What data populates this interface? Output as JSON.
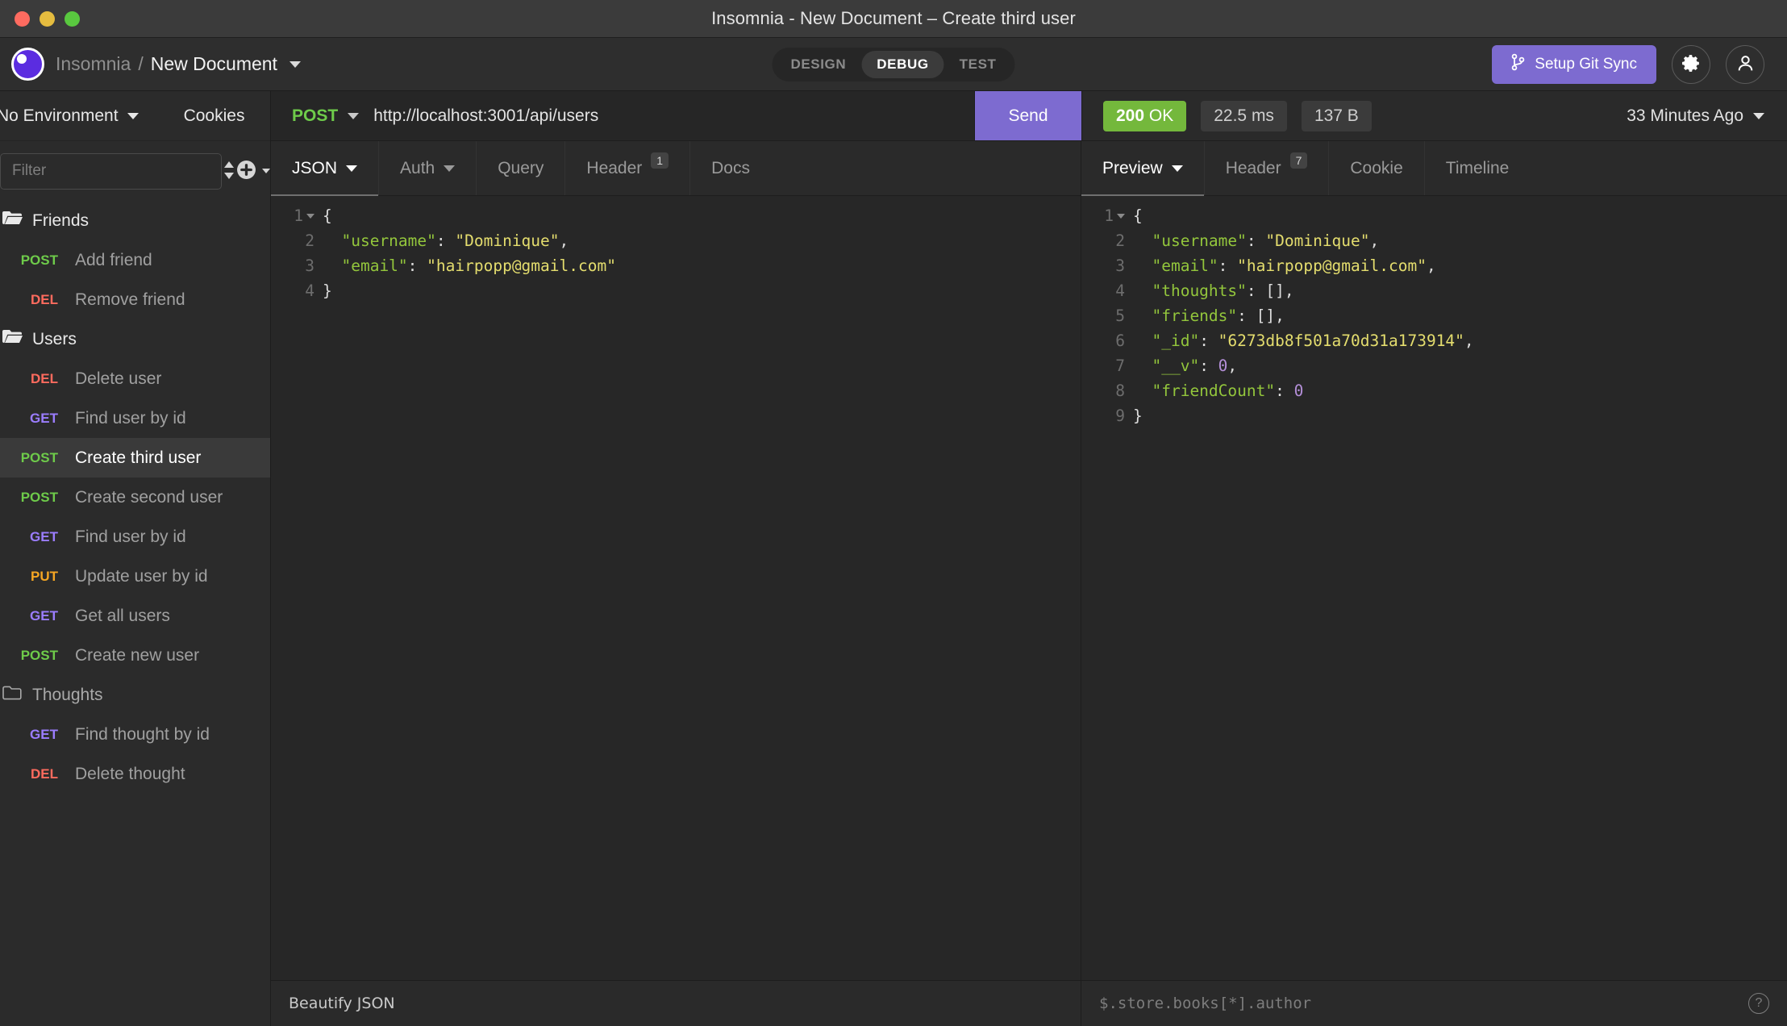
{
  "window": {
    "title": "Insomnia - New Document – Create third user"
  },
  "header": {
    "app_name": "Insomnia",
    "separator": "/",
    "document_name": "New Document",
    "modes": [
      {
        "label": "DESIGN",
        "active": false
      },
      {
        "label": "DEBUG",
        "active": true
      },
      {
        "label": "TEST",
        "active": false
      }
    ],
    "git_sync_label": "Setup Git Sync",
    "accent_color": "#7d6bd0"
  },
  "sidebar": {
    "environment_label": "No Environment",
    "cookies_label": "Cookies",
    "filter_placeholder": "Filter",
    "items": [
      {
        "type": "folder",
        "label": "Friends",
        "open": true
      },
      {
        "type": "request",
        "method": "POST",
        "label": "Add friend",
        "selected": false
      },
      {
        "type": "request",
        "method": "DEL",
        "label": "Remove friend",
        "selected": false
      },
      {
        "type": "folder",
        "label": "Users",
        "open": true
      },
      {
        "type": "request",
        "method": "DEL",
        "label": "Delete user",
        "selected": false
      },
      {
        "type": "request",
        "method": "GET",
        "label": "Find user by id",
        "selected": false
      },
      {
        "type": "request",
        "method": "POST",
        "label": "Create third user",
        "selected": true
      },
      {
        "type": "request",
        "method": "POST",
        "label": "Create second user",
        "selected": false
      },
      {
        "type": "request",
        "method": "GET",
        "label": "Find user by id",
        "selected": false
      },
      {
        "type": "request",
        "method": "PUT",
        "label": "Update user by id",
        "selected": false
      },
      {
        "type": "request",
        "method": "GET",
        "label": "Get all users",
        "selected": false
      },
      {
        "type": "request",
        "method": "POST",
        "label": "Create new user",
        "selected": false
      },
      {
        "type": "folder",
        "label": "Thoughts",
        "open": false
      },
      {
        "type": "request",
        "method": "GET",
        "label": "Find thought by id",
        "selected": false
      },
      {
        "type": "request",
        "method": "DEL",
        "label": "Delete thought",
        "selected": false
      }
    ],
    "method_colors": {
      "GET": "#9b7dff",
      "POST": "#6ecb4a",
      "PUT": "#f5a623",
      "DEL": "#ff6b5e"
    }
  },
  "request": {
    "method": "POST",
    "url": "http://localhost:3001/api/users",
    "send_label": "Send",
    "tabs": [
      {
        "label": "JSON",
        "active": true,
        "dropdown": true,
        "badge": null
      },
      {
        "label": "Auth",
        "active": false,
        "dropdown": true,
        "badge": null
      },
      {
        "label": "Query",
        "active": false,
        "dropdown": false,
        "badge": null
      },
      {
        "label": "Header",
        "active": false,
        "dropdown": false,
        "badge": "1"
      },
      {
        "label": "Docs",
        "active": false,
        "dropdown": false,
        "badge": null
      }
    ],
    "body_lines": [
      {
        "num": "1",
        "fold": true,
        "tokens": [
          {
            "t": "{",
            "c": "p"
          }
        ]
      },
      {
        "num": "2",
        "fold": false,
        "tokens": [
          {
            "t": "  \"username\"",
            "c": "k"
          },
          {
            "t": ": ",
            "c": "p"
          },
          {
            "t": "\"Dominique\"",
            "c": "s"
          },
          {
            "t": ",",
            "c": "p"
          }
        ]
      },
      {
        "num": "3",
        "fold": false,
        "tokens": [
          {
            "t": "  \"email\"",
            "c": "k"
          },
          {
            "t": ": ",
            "c": "p"
          },
          {
            "t": "\"hairpopp@gmail.com\"",
            "c": "s"
          }
        ]
      },
      {
        "num": "4",
        "fold": false,
        "tokens": [
          {
            "t": "}",
            "c": "p"
          }
        ]
      }
    ],
    "footer_label": "Beautify JSON"
  },
  "response": {
    "status_code": "200",
    "status_text": "OK",
    "status_color": "#74b83c",
    "time": "22.5 ms",
    "size": "137 B",
    "timestamp": "33 Minutes Ago",
    "tabs": [
      {
        "label": "Preview",
        "active": true,
        "dropdown": true,
        "badge": null
      },
      {
        "label": "Header",
        "active": false,
        "dropdown": false,
        "badge": "7"
      },
      {
        "label": "Cookie",
        "active": false,
        "dropdown": false,
        "badge": null
      },
      {
        "label": "Timeline",
        "active": false,
        "dropdown": false,
        "badge": null
      }
    ],
    "body_lines": [
      {
        "num": "1",
        "fold": true,
        "tokens": [
          {
            "t": "{",
            "c": "p"
          }
        ]
      },
      {
        "num": "2",
        "fold": false,
        "tokens": [
          {
            "t": "  \"username\"",
            "c": "k"
          },
          {
            "t": ": ",
            "c": "p"
          },
          {
            "t": "\"Dominique\"",
            "c": "s"
          },
          {
            "t": ",",
            "c": "p"
          }
        ]
      },
      {
        "num": "3",
        "fold": false,
        "tokens": [
          {
            "t": "  \"email\"",
            "c": "k"
          },
          {
            "t": ": ",
            "c": "p"
          },
          {
            "t": "\"hairpopp@gmail.com\"",
            "c": "s"
          },
          {
            "t": ",",
            "c": "p"
          }
        ]
      },
      {
        "num": "4",
        "fold": false,
        "tokens": [
          {
            "t": "  \"thoughts\"",
            "c": "k"
          },
          {
            "t": ": [],",
            "c": "p"
          }
        ]
      },
      {
        "num": "5",
        "fold": false,
        "tokens": [
          {
            "t": "  \"friends\"",
            "c": "k"
          },
          {
            "t": ": [],",
            "c": "p"
          }
        ]
      },
      {
        "num": "6",
        "fold": false,
        "tokens": [
          {
            "t": "  \"_id\"",
            "c": "k"
          },
          {
            "t": ": ",
            "c": "p"
          },
          {
            "t": "\"6273db8f501a70d31a173914\"",
            "c": "s"
          },
          {
            "t": ",",
            "c": "p"
          }
        ]
      },
      {
        "num": "7",
        "fold": false,
        "tokens": [
          {
            "t": "  \"__v\"",
            "c": "k"
          },
          {
            "t": ": ",
            "c": "p"
          },
          {
            "t": "0",
            "c": "n"
          },
          {
            "t": ",",
            "c": "p"
          }
        ]
      },
      {
        "num": "8",
        "fold": false,
        "tokens": [
          {
            "t": "  \"friendCount\"",
            "c": "k"
          },
          {
            "t": ": ",
            "c": "p"
          },
          {
            "t": "0",
            "c": "n"
          }
        ]
      },
      {
        "num": "9",
        "fold": false,
        "tokens": [
          {
            "t": "}",
            "c": "p"
          }
        ]
      }
    ],
    "filter_placeholder": "$.store.books[*].author",
    "help_glyph": "?"
  }
}
